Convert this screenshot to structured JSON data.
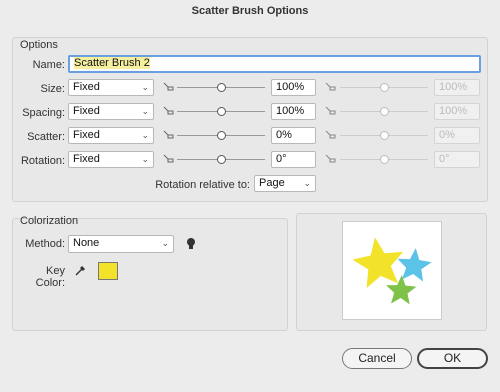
{
  "window": {
    "title": "Scatter Brush Options"
  },
  "options": {
    "group_title": "Options",
    "name_label": "Name:",
    "name_value": "Scatter Brush 2",
    "rows": [
      {
        "label": "Size:",
        "method": "Fixed",
        "value": "100%",
        "value2": "100%",
        "slider": 0.5
      },
      {
        "label": "Spacing:",
        "method": "Fixed",
        "value": "100%",
        "value2": "100%",
        "slider": 0.5
      },
      {
        "label": "Scatter:",
        "method": "Fixed",
        "value": "0%",
        "value2": "0%",
        "slider": 0.5
      },
      {
        "label": "Rotation:",
        "method": "Fixed",
        "value": "0°",
        "value2": "0°",
        "slider": 0.5
      }
    ],
    "rotation_relative_label": "Rotation relative to:",
    "rotation_relative_value": "Page"
  },
  "colorization": {
    "group_title": "Colorization",
    "method_label": "Method:",
    "method_value": "None",
    "key_color_label": "Key Color:",
    "key_color": "#f2e22a",
    "tip_icon": "lightbulb-icon",
    "eyedropper_icon": "eyedropper-icon"
  },
  "preview": {
    "stars": [
      {
        "color": "#f2e22a"
      },
      {
        "color": "#5bc2e8"
      },
      {
        "color": "#7fc24a"
      }
    ]
  },
  "buttons": {
    "cancel": "Cancel",
    "ok": "OK"
  }
}
